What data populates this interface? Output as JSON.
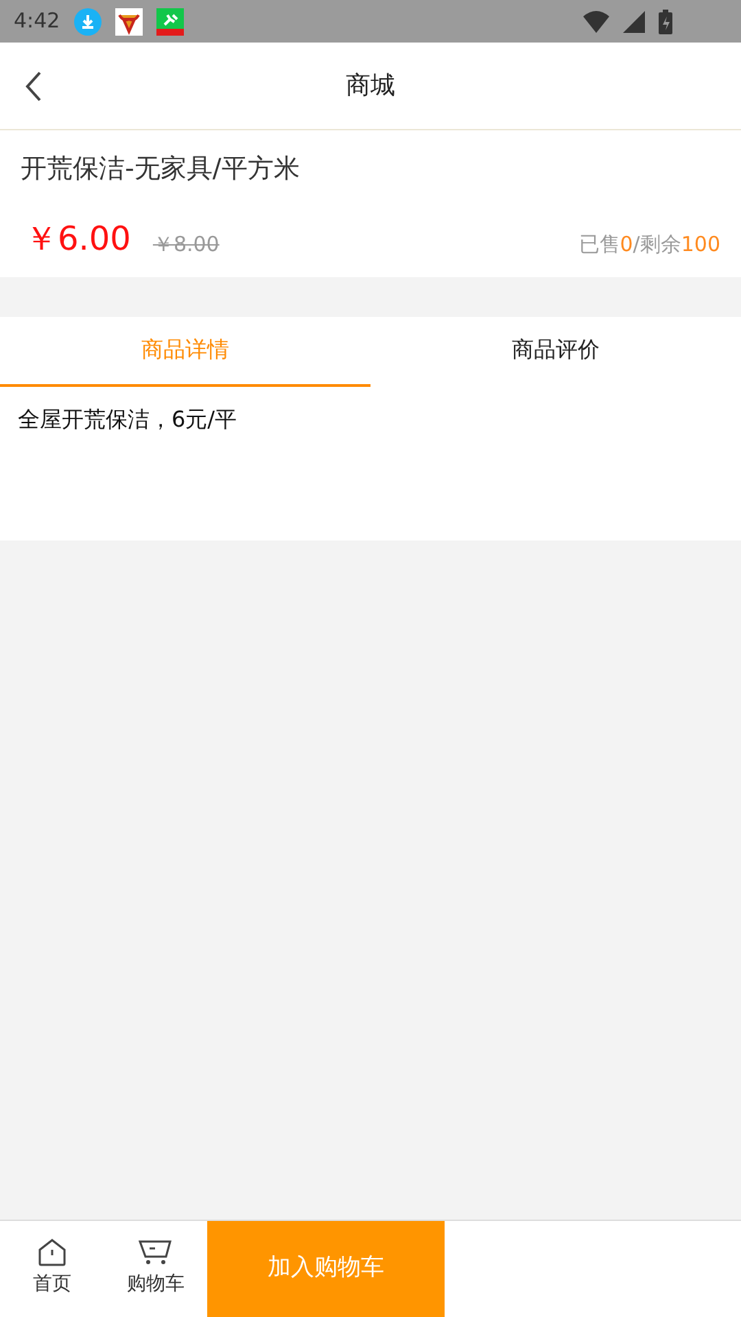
{
  "status_bar": {
    "time": "4:42"
  },
  "header": {
    "title": "商城"
  },
  "product": {
    "name": "开荒保洁-无家具/平方米",
    "price": "￥6.00",
    "original_price": "￥8.00",
    "stock": [
      {
        "text": "已售",
        "kind": "label"
      },
      {
        "text": "0",
        "kind": "value"
      },
      {
        "text": "/剩余",
        "kind": "label"
      },
      {
        "text": "100",
        "kind": "value"
      }
    ]
  },
  "tabs": [
    {
      "label": "商品详情",
      "selected": true
    },
    {
      "label": "商品评价",
      "selected": false
    }
  ],
  "detail": {
    "text": "全屋开荒保洁，6元/平"
  },
  "bottom_bar": {
    "items": [
      {
        "label": "首页",
        "kind": "home"
      },
      {
        "label": "购物车",
        "kind": "cart"
      }
    ],
    "add_to_cart": "加入购物车"
  }
}
